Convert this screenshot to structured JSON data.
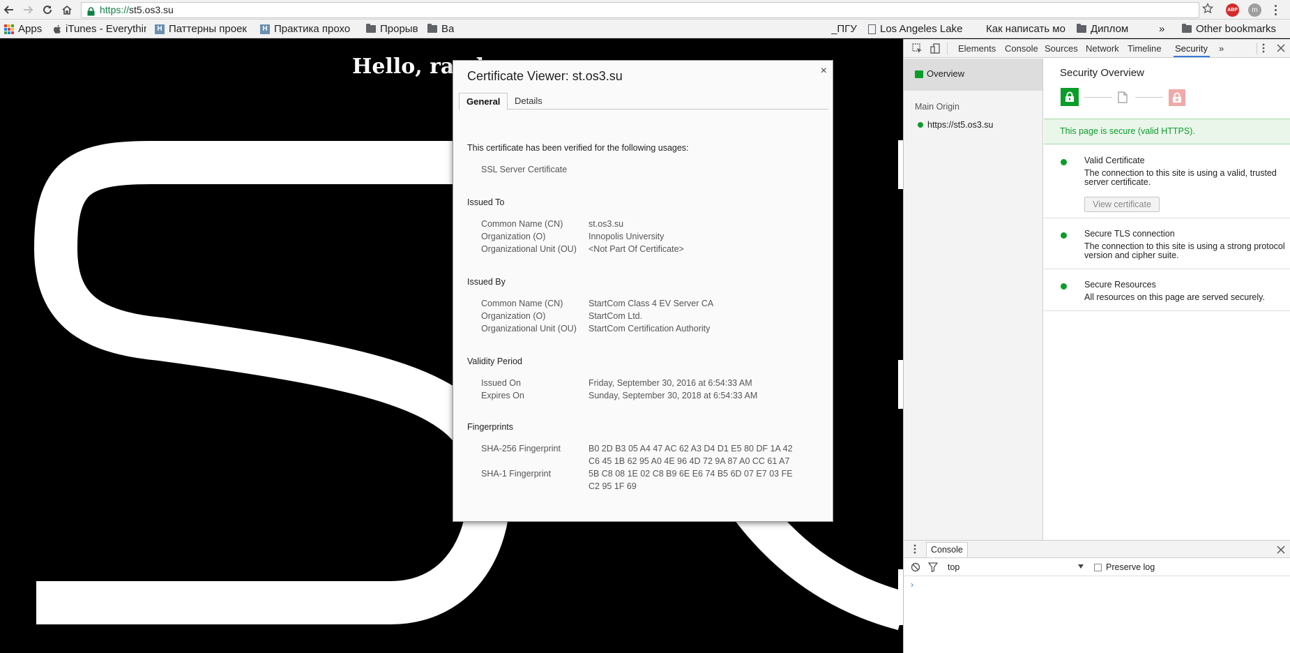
{
  "browser": {
    "url_scheme": "https://",
    "url_host": "st5.os3.su",
    "bookmarks": [
      {
        "label": "Apps",
        "icon": "apps-icon"
      },
      {
        "label": "iTunes - Everythin",
        "icon": "apple-icon"
      },
      {
        "label": "Паттерны проек",
        "icon": "habr-icon"
      },
      {
        "label": "Практика прохо",
        "icon": "habr-icon"
      },
      {
        "label": "Прорыв",
        "icon": "folder-icon"
      },
      {
        "label": "Ва",
        "icon": "folder-icon"
      },
      {
        "label": "_ПГУ",
        "icon": "none"
      },
      {
        "label": "Los Angeles Lake",
        "icon": "doc-icon"
      },
      {
        "label": "Как написать мо",
        "icon": "none"
      },
      {
        "label": "Диплом",
        "icon": "folder-icon"
      },
      {
        "label": "»",
        "icon": "none"
      },
      {
        "label": "Other bookmarks",
        "icon": "folder-icon"
      }
    ],
    "ext_abp": "ABP",
    "ext_user": "m"
  },
  "page": {
    "heading": "Hello, rand"
  },
  "cert_dialog": {
    "title": "Certificate Viewer: st.os3.su",
    "close": "×",
    "tabs": [
      "General",
      "Details"
    ],
    "verified_text": "This certificate has been verified for the following usages:",
    "usage": "SSL Server Certificate",
    "issued_to_heading": "Issued To",
    "issued_to": [
      {
        "key": "Common Name (CN)",
        "value": "st.os3.su"
      },
      {
        "key": "Organization (O)",
        "value": "Innopolis University"
      },
      {
        "key": "Organizational Unit (OU)",
        "value": "<Not Part Of Certificate>"
      }
    ],
    "issued_by_heading": "Issued By",
    "issued_by": [
      {
        "key": "Common Name (CN)",
        "value": "StartCom Class 4 EV Server CA"
      },
      {
        "key": "Organization (O)",
        "value": "StartCom Ltd."
      },
      {
        "key": "Organizational Unit (OU)",
        "value": "StartCom Certification Authority"
      }
    ],
    "validity_heading": "Validity Period",
    "validity": [
      {
        "key": "Issued On",
        "value": "Friday, September 30, 2016 at 6:54:33 AM"
      },
      {
        "key": "Expires On",
        "value": "Sunday, September 30, 2018 at 6:54:33 AM"
      }
    ],
    "fingerprints_heading": "Fingerprints",
    "sha256_key": "SHA-256 Fingerprint",
    "sha256_line1": "B0 2D B3 05 A4 47 AC 62 A3 D4 D1 E5 80 DF 1A 42",
    "sha256_line2": "C6 45 1B 62 95 A0 4E 96 4D 72 9A 87 A0 CC 61 A7",
    "sha1_key": "SHA-1 Fingerprint",
    "sha1_line1": "5B C8 08 1E 02 C8 B9 6E E6 74 B5 6D 07 E7 03 FE",
    "sha1_line2": "C2 95 1F 69"
  },
  "devtools": {
    "tabs": [
      "Elements",
      "Console",
      "Sources",
      "Network",
      "Timeline",
      "Security"
    ],
    "more": "»",
    "active_tab": "Security",
    "sidebar": {
      "overview": "Overview",
      "main_origin_heading": "Main Origin",
      "origin": "https://st5.os3.su"
    },
    "security": {
      "title": "Security Overview",
      "banner": "This page is secure (valid HTTPS).",
      "items": [
        {
          "title": "Valid Certificate",
          "desc": "The connection to this site is using a valid, trusted server certificate."
        },
        {
          "title": "Secure TLS connection",
          "desc": "The connection to this site is using a strong protocol version and cipher suite."
        },
        {
          "title": "Secure Resources",
          "desc": "All resources on this page are served securely."
        }
      ],
      "view_cert_button": "View certificate"
    },
    "console": {
      "tab": "Console",
      "context": "top",
      "preserve_log": "Preserve log",
      "prompt": "›"
    },
    "colors": {
      "secure_green": "#0b9d2a",
      "active_tab_blue": "#3879d9"
    }
  }
}
